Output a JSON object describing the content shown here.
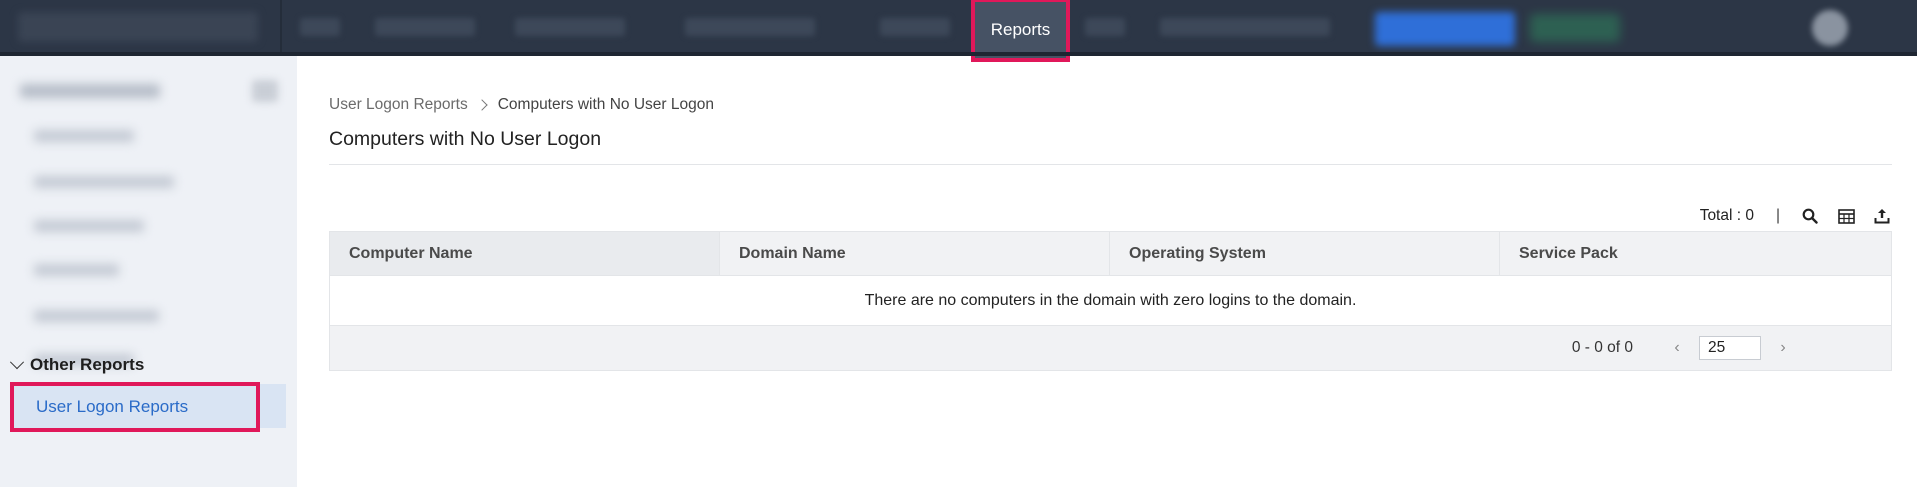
{
  "topbar": {
    "active_tab": "Reports"
  },
  "sidebar": {
    "group_label": "Other Reports",
    "active_item": "User Logon Reports"
  },
  "breadcrumb": {
    "parent": "User Logon Reports",
    "current": "Computers with No User Logon"
  },
  "page": {
    "title": "Computers with No User Logon"
  },
  "toolbar": {
    "total_label": "Total : 0",
    "separator": "|"
  },
  "table": {
    "columns": [
      "Computer Name",
      "Domain Name",
      "Operating System",
      "Service Pack"
    ],
    "empty_message": "There are no computers in the domain with zero logins to the domain."
  },
  "pagination": {
    "range": "0 - 0 of 0",
    "page_size": "25"
  },
  "colors": {
    "topbar": "#2c3646",
    "highlight": "#e0185a",
    "link": "#2a6bc8"
  }
}
